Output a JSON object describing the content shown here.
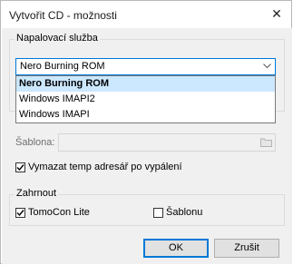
{
  "window": {
    "title": "Vytvořit CD - možnosti",
    "close_glyph": "✕"
  },
  "burn_service": {
    "group_label": "Napalovací služba",
    "selected": "Nero Burning ROM",
    "options": [
      "Nero Burning ROM",
      "Windows IMAPI2",
      "Windows IMAPI"
    ]
  },
  "template": {
    "label": "Šablona:",
    "value": ""
  },
  "delete_temp": {
    "label": "Vymazat temp adresář po vypálení",
    "checked": true
  },
  "include": {
    "group_label": "Zahrnout",
    "tomocon_lite": {
      "label": "TomoCon Lite",
      "checked": true
    },
    "sablonu": {
      "label": "Šablonu",
      "checked": false
    }
  },
  "buttons": {
    "ok": "OK",
    "cancel": "Zrušit"
  },
  "icons": {
    "folder": "folder-icon",
    "dropdown": "chevron-down-icon",
    "check": "checkmark-icon"
  }
}
